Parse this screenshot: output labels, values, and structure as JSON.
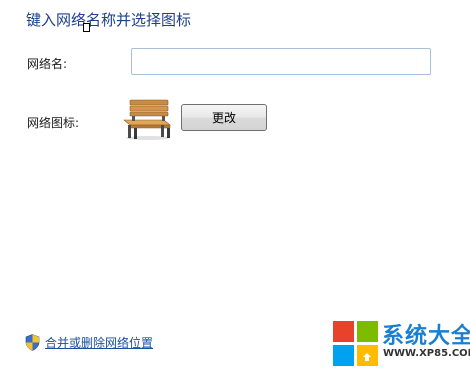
{
  "heading": "键入网络名称并选择图标",
  "network_name": {
    "label": "网络名:",
    "value": "",
    "placeholder": ""
  },
  "network_icon": {
    "label": "网络图标:",
    "icon_name": "park-bench-icon",
    "change_button": "更改"
  },
  "merge_link": {
    "icon_name": "uac-shield-icon",
    "label": "合并或删除网络位置"
  },
  "watermark": {
    "title": "系统大全",
    "url": "WWW.XP85.COM",
    "colors": [
      "#e8412c",
      "#7cbb00",
      "#00a1f1",
      "#ffbb00"
    ]
  },
  "colors": {
    "heading": "#1e3f8c",
    "link": "#1a4f9c",
    "input_border": "#a8bfd8"
  }
}
